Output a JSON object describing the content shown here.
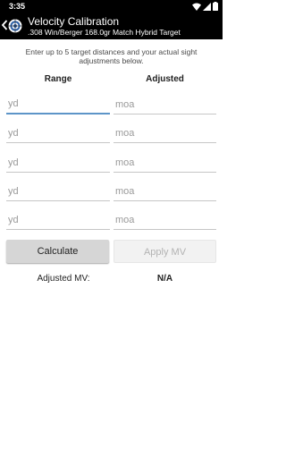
{
  "status_bar": {
    "time": "3:35",
    "icons": [
      "wifi-icon",
      "signal-icon",
      "battery-icon"
    ]
  },
  "action_bar": {
    "title": "Velocity Calibration",
    "subtitle": ".308 Win/Berger 168.0gr Match Hybrid Target"
  },
  "instructions": "Enter up to 5 target distances and your actual sight adjustments below.",
  "columns": {
    "range": "Range",
    "adjusted": "Adjusted"
  },
  "rows": [
    {
      "range_placeholder": "yd",
      "adjusted_placeholder": "moa",
      "range_value": "",
      "adjusted_value": ""
    },
    {
      "range_placeholder": "yd",
      "adjusted_placeholder": "moa",
      "range_value": "",
      "adjusted_value": ""
    },
    {
      "range_placeholder": "yd",
      "adjusted_placeholder": "moa",
      "range_value": "",
      "adjusted_value": ""
    },
    {
      "range_placeholder": "yd",
      "adjusted_placeholder": "moa",
      "range_value": "",
      "adjusted_value": ""
    },
    {
      "range_placeholder": "yd",
      "adjusted_placeholder": "moa",
      "range_value": "",
      "adjusted_value": ""
    }
  ],
  "buttons": {
    "calculate": "Calculate",
    "apply_mv": "Apply MV"
  },
  "result": {
    "label": "Adjusted MV:",
    "value": "N/A"
  },
  "colors": {
    "status_bar_bg": "#000000",
    "action_bar_bg": "#000000",
    "focus_underline": "#5d95c8",
    "calculate_bg": "#d6d6d6",
    "apply_disabled_text": "#b3b3b3"
  }
}
